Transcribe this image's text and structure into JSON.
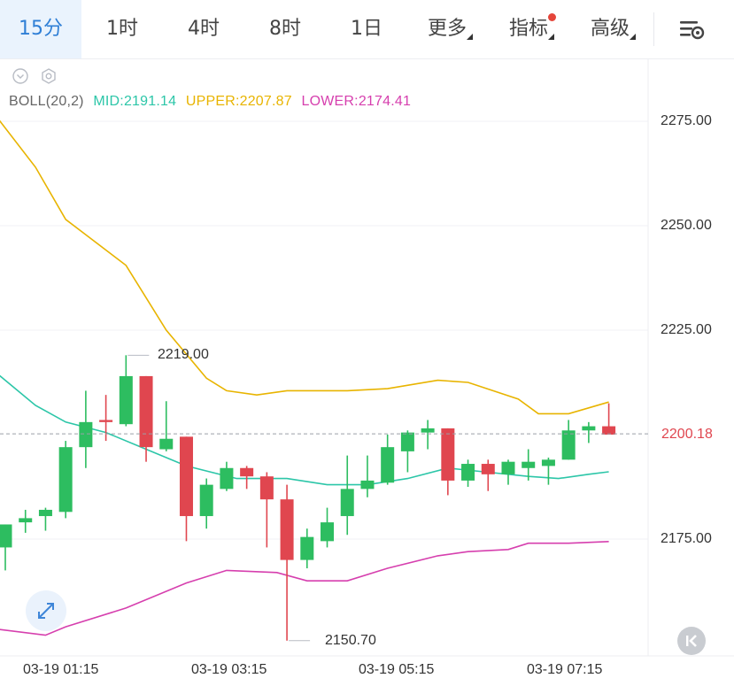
{
  "toolbar": {
    "timeframes": [
      "15分",
      "1时",
      "4时",
      "8时",
      "1日"
    ],
    "more": "更多",
    "indicators": "指标",
    "advanced": "高级"
  },
  "indicator": {
    "name": "BOLL(20,2)",
    "mid": "MID:2191.14",
    "upper": "UPPER:2207.87",
    "lower": "LOWER:2174.41"
  },
  "colors": {
    "up": "#2dbd60",
    "down": "#e0464f",
    "mid": "#2cc6a8",
    "upper": "#e8b400",
    "lower": "#d63fae",
    "accent": "#2f7fd6"
  },
  "chart_data": {
    "type": "candlestick",
    "y_axis_labels": [
      "2275.00",
      "2250.00",
      "2225.00",
      "2175.00"
    ],
    "current_price": "2200.18",
    "x_axis_labels": [
      "03-19 01:15",
      "03-19 03:15",
      "03-19 05:15",
      "03-19 07:15"
    ],
    "max_label": "2219.00",
    "min_label": "2150.70",
    "candles": [
      {
        "o": 2173.0,
        "h": 2178.5,
        "l": 2167.5,
        "c": 2178.5
      },
      {
        "o": 2179.0,
        "h": 2182.0,
        "l": 2176.5,
        "c": 2180.0
      },
      {
        "o": 2180.5,
        "h": 2182.5,
        "l": 2177.0,
        "c": 2182.0
      },
      {
        "o": 2181.5,
        "h": 2198.5,
        "l": 2180.0,
        "c": 2197.0
      },
      {
        "o": 2197.0,
        "h": 2210.5,
        "l": 2192.0,
        "c": 2203.0
      },
      {
        "o": 2203.5,
        "h": 2209.5,
        "l": 2198.5,
        "c": 2203.0
      },
      {
        "o": 2202.5,
        "h": 2219.0,
        "l": 2202.0,
        "c": 2214.0
      },
      {
        "o": 2214.0,
        "h": 2214.0,
        "l": 2193.5,
        "c": 2197.0
      },
      {
        "o": 2196.5,
        "h": 2208.0,
        "l": 2196.0,
        "c": 2199.0
      },
      {
        "o": 2199.5,
        "h": 2199.5,
        "l": 2174.5,
        "c": 2180.5
      },
      {
        "o": 2180.5,
        "h": 2189.5,
        "l": 2177.5,
        "c": 2188.0
      },
      {
        "o": 2187.0,
        "h": 2193.5,
        "l": 2186.5,
        "c": 2192.0
      },
      {
        "o": 2192.0,
        "h": 2192.5,
        "l": 2187.0,
        "c": 2190.0
      },
      {
        "o": 2190.0,
        "h": 2191.0,
        "l": 2173.0,
        "c": 2184.5
      },
      {
        "o": 2184.5,
        "h": 2188.0,
        "l": 2150.7,
        "c": 2170.0
      },
      {
        "o": 2170.0,
        "h": 2177.5,
        "l": 2168.0,
        "c": 2175.5
      },
      {
        "o": 2174.5,
        "h": 2182.5,
        "l": 2173.0,
        "c": 2179.0
      },
      {
        "o": 2180.5,
        "h": 2195.0,
        "l": 2176.0,
        "c": 2187.0
      },
      {
        "o": 2187.0,
        "h": 2195.0,
        "l": 2185.0,
        "c": 2189.0
      },
      {
        "o": 2188.5,
        "h": 2200.0,
        "l": 2188.0,
        "c": 2197.0
      },
      {
        "o": 2196.0,
        "h": 2201.0,
        "l": 2191.0,
        "c": 2200.5
      },
      {
        "o": 2200.5,
        "h": 2203.5,
        "l": 2196.5,
        "c": 2201.5
      },
      {
        "o": 2201.5,
        "h": 2201.5,
        "l": 2185.5,
        "c": 2189.0
      },
      {
        "o": 2189.0,
        "h": 2194.0,
        "l": 2187.5,
        "c": 2193.0
      },
      {
        "o": 2193.0,
        "h": 2194.0,
        "l": 2186.5,
        "c": 2190.5
      },
      {
        "o": 2190.5,
        "h": 2194.0,
        "l": 2188.0,
        "c": 2193.5
      },
      {
        "o": 2192.0,
        "h": 2196.5,
        "l": 2189.0,
        "c": 2193.5
      },
      {
        "o": 2192.5,
        "h": 2194.5,
        "l": 2188.0,
        "c": 2194.0
      },
      {
        "o": 2194.0,
        "h": 2203.5,
        "l": 2194.0,
        "c": 2201.0
      },
      {
        "o": 2201.0,
        "h": 2203.0,
        "l": 2198.0,
        "c": 2202.0
      },
      {
        "o": 2202.0,
        "h": 2207.5,
        "l": 2200.0,
        "c": 2200.0
      }
    ],
    "upper_band": [
      [
        -0.5,
        2276.5
      ],
      [
        1.5,
        2264.0
      ],
      [
        3.0,
        2251.5
      ],
      [
        6.0,
        2240.5
      ],
      [
        8.0,
        2225.0
      ],
      [
        10.0,
        2213.5
      ],
      [
        11.0,
        2210.5
      ],
      [
        12.5,
        2209.5
      ],
      [
        14.0,
        2210.5
      ],
      [
        17.0,
        2210.5
      ],
      [
        19.0,
        2211.0
      ],
      [
        21.5,
        2213.0
      ],
      [
        23.0,
        2212.5
      ],
      [
        25.5,
        2208.5
      ],
      [
        26.5,
        2205.0
      ],
      [
        28.0,
        2205.0
      ],
      [
        30.0,
        2207.8
      ]
    ],
    "mid_band": [
      [
        -0.5,
        2215.0
      ],
      [
        1.5,
        2207.0
      ],
      [
        3.0,
        2203.0
      ],
      [
        5.0,
        2200.5
      ],
      [
        7.0,
        2196.5
      ],
      [
        9.0,
        2192.5
      ],
      [
        11.5,
        2189.5
      ],
      [
        14.0,
        2189.5
      ],
      [
        16.0,
        2188.0
      ],
      [
        18.0,
        2188.0
      ],
      [
        20.0,
        2189.5
      ],
      [
        22.0,
        2192.0
      ],
      [
        24.0,
        2191.0
      ],
      [
        26.0,
        2190.0
      ],
      [
        27.5,
        2189.5
      ],
      [
        29.0,
        2190.5
      ],
      [
        30.0,
        2191.1
      ]
    ],
    "lower_band": [
      [
        -0.5,
        2153.5
      ],
      [
        2.0,
        2152.0
      ],
      [
        3.0,
        2154.0
      ],
      [
        6.0,
        2158.5
      ],
      [
        9.0,
        2164.5
      ],
      [
        11.0,
        2167.5
      ],
      [
        13.5,
        2167.0
      ],
      [
        15.0,
        2165.0
      ],
      [
        17.0,
        2165.0
      ],
      [
        19.0,
        2168.0
      ],
      [
        21.5,
        2171.0
      ],
      [
        23.0,
        2172.0
      ],
      [
        25.0,
        2172.5
      ],
      [
        26.0,
        2174.0
      ],
      [
        28.0,
        2174.0
      ],
      [
        30.0,
        2174.4
      ]
    ]
  }
}
